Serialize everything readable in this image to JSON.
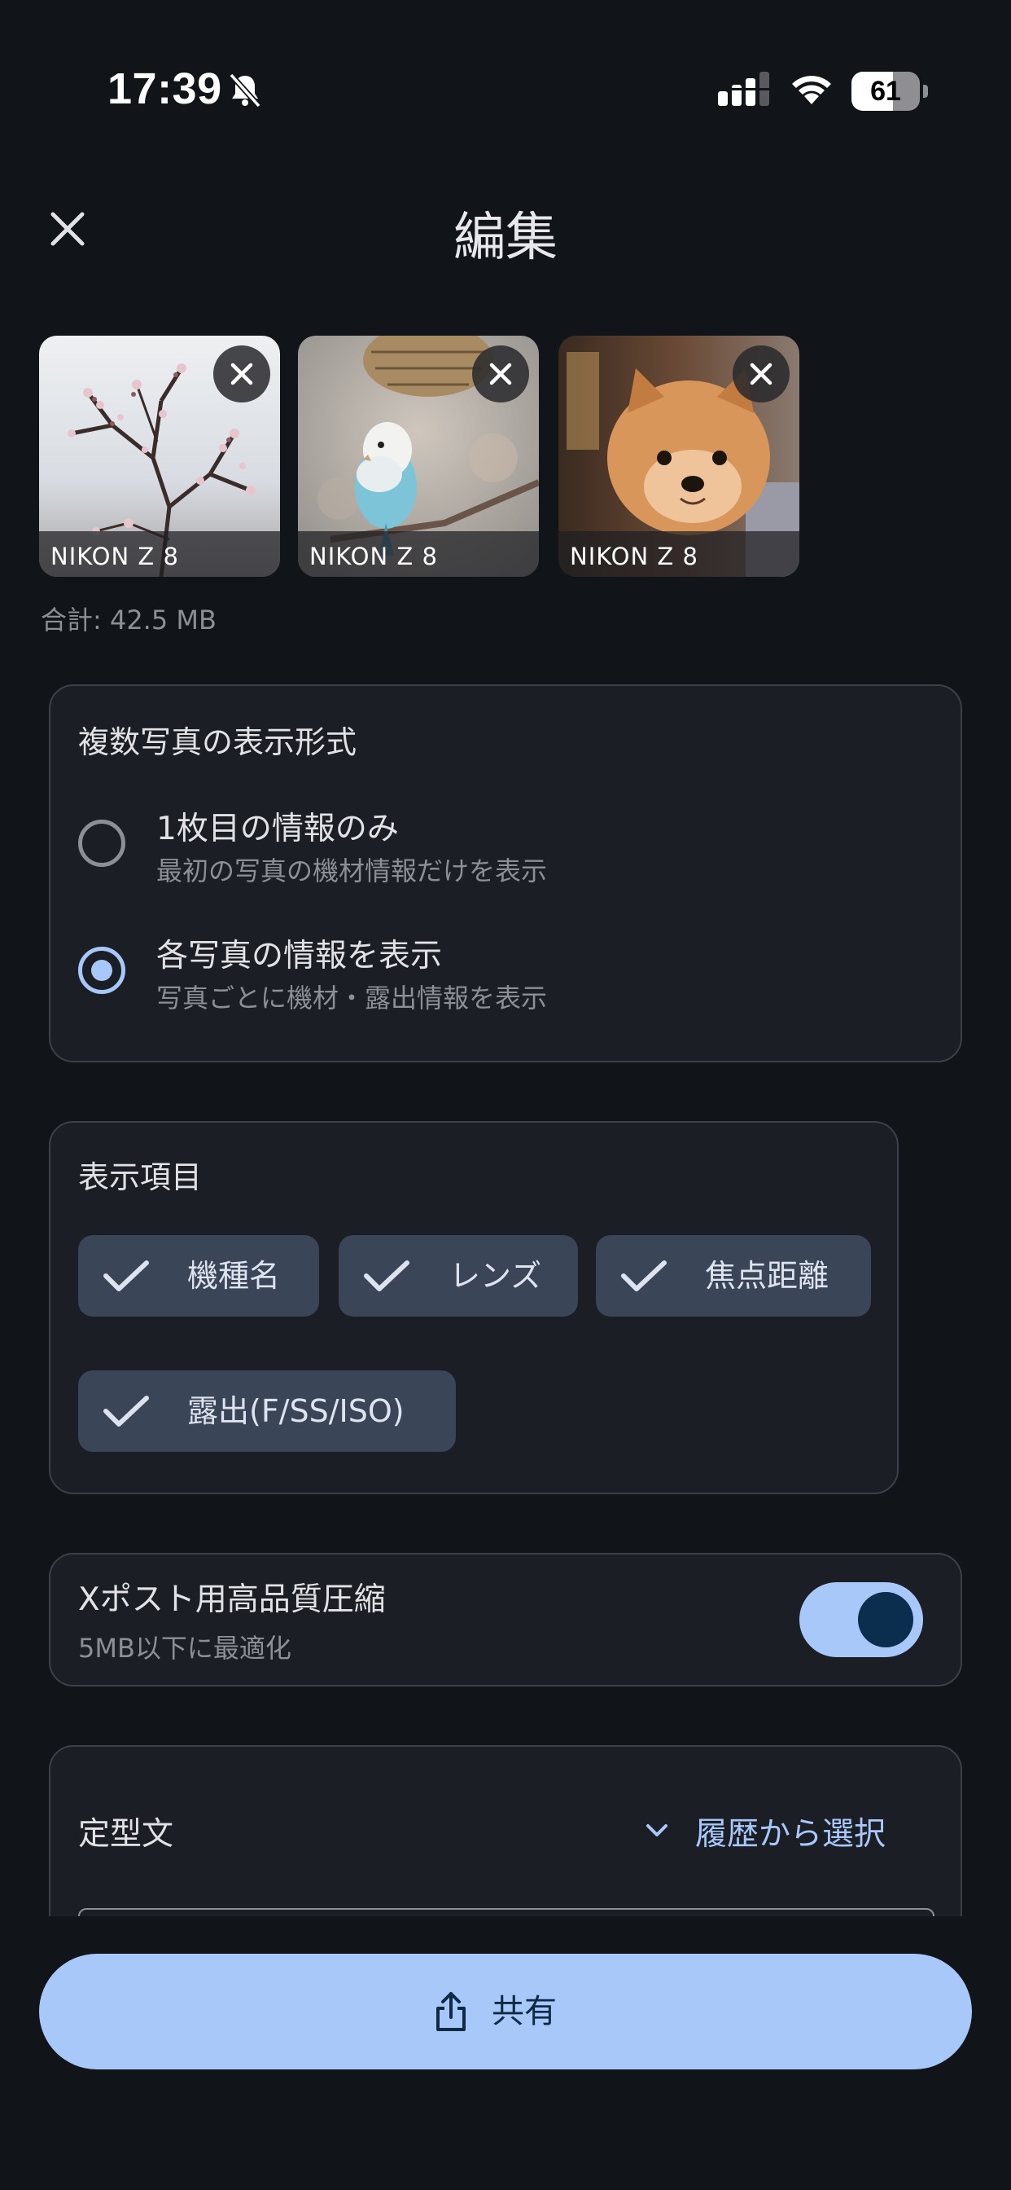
{
  "status_bar": {
    "time": "17:39",
    "battery_level": "61",
    "battery_fraction": 0.61,
    "icons": [
      "bell-slash-icon",
      "cellular-signal-icon",
      "wifi-icon",
      "battery-icon"
    ]
  },
  "header": {
    "title": "編集",
    "close_icon": "close-icon"
  },
  "photos": [
    {
      "label": "NIKON Z 8",
      "subject": "cherry blossom branch"
    },
    {
      "label": "NIKON Z 8",
      "subject": "budgerigar"
    },
    {
      "label": "NIKON Z 8",
      "subject": "pomeranian dog"
    }
  ],
  "total_size": "合計: 42.5 MB",
  "display_format": {
    "title": "複数写真の表示形式",
    "options": [
      {
        "title": "1枚目の情報のみ",
        "subtitle": "最初の写真の機材情報だけを表示",
        "selected": false
      },
      {
        "title": "各写真の情報を表示",
        "subtitle": "写真ごとに機材・露出情報を表示",
        "selected": true
      }
    ]
  },
  "display_items": {
    "title": "表示項目",
    "chips": [
      {
        "label": "機種名",
        "checked": true
      },
      {
        "label": "レンズ",
        "checked": true
      },
      {
        "label": "焦点距離",
        "checked": true
      },
      {
        "label": "露出(F/SS/ISO)",
        "checked": true
      }
    ]
  },
  "compression": {
    "title": "Xポスト用高品質圧縮",
    "subtitle": "5MB以下に最適化",
    "enabled": true
  },
  "template": {
    "title": "定型文",
    "dropdown_label": "履歴から選択"
  },
  "share_button": {
    "label": "共有",
    "icon": "share-icon"
  },
  "colors": {
    "background": "#111418",
    "card": "#1b1e24",
    "accent": "#a8c8fa",
    "chip": "#3b4558"
  }
}
